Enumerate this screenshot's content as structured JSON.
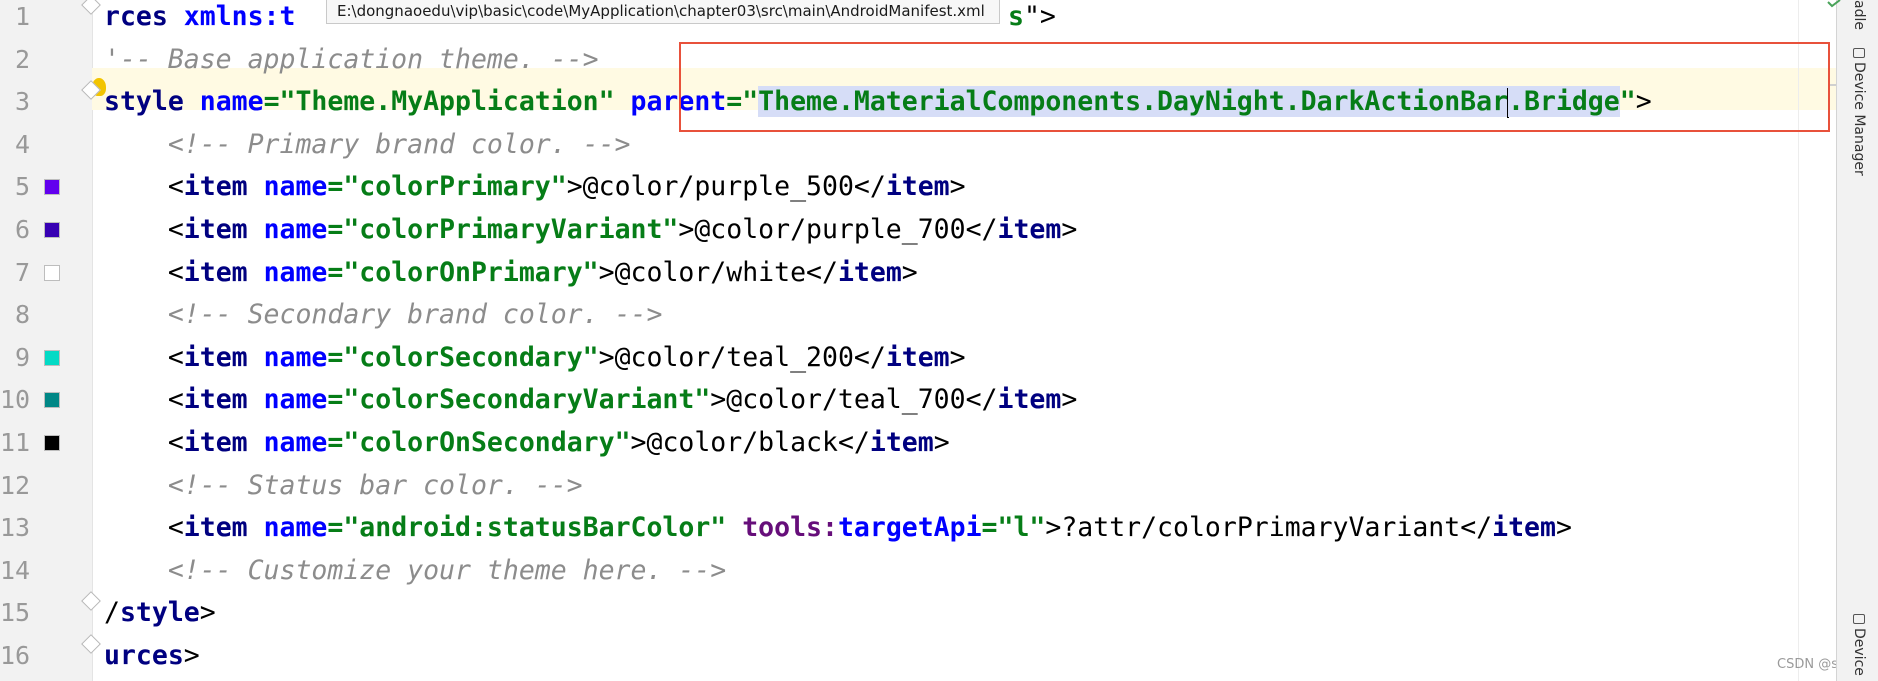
{
  "tooltip": {
    "path": "E:\\dongnaoedu\\vip\\basic\\code\\MyApplication\\chapter03\\src\\main\\AndroidManifest.xml"
  },
  "side_panel": {
    "tab_top": "Device Manager",
    "tab_bottom": "Device",
    "tab_partial": "adle"
  },
  "watermark": "CSDN @serier",
  "colors": {
    "purple_500": "#6200ee",
    "purple_700": "#3700b3",
    "white": "#ffffff",
    "teal_200": "#03dac5",
    "teal_700": "#018786",
    "black": "#000000",
    "annotation": "#e8513b"
  },
  "lines": [
    {
      "n": "1",
      "tokens": [
        {
          "c": "tag",
          "t": "rces "
        },
        {
          "c": "attr",
          "t": "xmlns:t"
        }
      ],
      "tail": [
        {
          "c": "val",
          "t": "s"
        },
        {
          "c": "txt",
          "t": "\">"
        }
      ]
    },
    {
      "n": "2",
      "tokens": [
        {
          "c": "cmt",
          "t": "'-- Base application theme. -->"
        }
      ]
    },
    {
      "n": "3",
      "tokens": [
        {
          "c": "tag",
          "t": "style "
        },
        {
          "c": "attr",
          "t": "name"
        },
        {
          "c": "val",
          "t": "=\"Theme.MyApplication\" "
        },
        {
          "c": "attr",
          "t": "parent"
        },
        {
          "c": "val",
          "t": "=\""
        },
        {
          "c": "val sel",
          "t": "Theme.MaterialComponents.DayNight.DarkActionBar"
        },
        {
          "c": "caret",
          "t": ""
        },
        {
          "c": "val sel",
          "t": ".Bridge"
        },
        {
          "c": "val",
          "t": "\""
        },
        {
          "c": "txt",
          "t": ">"
        }
      ]
    },
    {
      "n": "4",
      "tokens": [
        {
          "c": "cmt",
          "t": "    <!-- Primary brand color. -->"
        }
      ]
    },
    {
      "n": "5",
      "tokens": [
        {
          "c": "txt",
          "t": "    <"
        },
        {
          "c": "tag",
          "t": "item "
        },
        {
          "c": "attr",
          "t": "name"
        },
        {
          "c": "val",
          "t": "=\"colorPrimary\""
        },
        {
          "c": "txt",
          "t": ">@color/purple_500</"
        },
        {
          "c": "tag",
          "t": "item"
        },
        {
          "c": "txt",
          "t": ">"
        }
      ]
    },
    {
      "n": "6",
      "tokens": [
        {
          "c": "txt",
          "t": "    <"
        },
        {
          "c": "tag",
          "t": "item "
        },
        {
          "c": "attr",
          "t": "name"
        },
        {
          "c": "val",
          "t": "=\"colorPrimaryVariant\""
        },
        {
          "c": "txt",
          "t": ">@color/purple_700</"
        },
        {
          "c": "tag",
          "t": "item"
        },
        {
          "c": "txt",
          "t": ">"
        }
      ]
    },
    {
      "n": "7",
      "tokens": [
        {
          "c": "txt",
          "t": "    <"
        },
        {
          "c": "tag",
          "t": "item "
        },
        {
          "c": "attr",
          "t": "name"
        },
        {
          "c": "val",
          "t": "=\"colorOnPrimary\""
        },
        {
          "c": "txt",
          "t": ">@color/white</"
        },
        {
          "c": "tag",
          "t": "item"
        },
        {
          "c": "txt",
          "t": ">"
        }
      ]
    },
    {
      "n": "8",
      "tokens": [
        {
          "c": "cmt",
          "t": "    <!-- Secondary brand color. -->"
        }
      ]
    },
    {
      "n": "9",
      "tokens": [
        {
          "c": "txt",
          "t": "    <"
        },
        {
          "c": "tag",
          "t": "item "
        },
        {
          "c": "attr",
          "t": "name"
        },
        {
          "c": "val",
          "t": "=\"colorSecondary\""
        },
        {
          "c": "txt",
          "t": ">@color/teal_200</"
        },
        {
          "c": "tag",
          "t": "item"
        },
        {
          "c": "txt",
          "t": ">"
        }
      ]
    },
    {
      "n": "10",
      "tokens": [
        {
          "c": "txt",
          "t": "    <"
        },
        {
          "c": "tag",
          "t": "item "
        },
        {
          "c": "attr",
          "t": "name"
        },
        {
          "c": "val",
          "t": "=\"colorSecondaryVariant\""
        },
        {
          "c": "txt",
          "t": ">@color/teal_700</"
        },
        {
          "c": "tag",
          "t": "item"
        },
        {
          "c": "txt",
          "t": ">"
        }
      ]
    },
    {
      "n": "11",
      "tokens": [
        {
          "c": "txt",
          "t": "    <"
        },
        {
          "c": "tag",
          "t": "item "
        },
        {
          "c": "attr",
          "t": "name"
        },
        {
          "c": "val",
          "t": "=\"colorOnSecondary\""
        },
        {
          "c": "txt",
          "t": ">@color/black</"
        },
        {
          "c": "tag",
          "t": "item"
        },
        {
          "c": "txt",
          "t": ">"
        }
      ]
    },
    {
      "n": "12",
      "tokens": [
        {
          "c": "cmt",
          "t": "    <!-- Status bar color. -->"
        }
      ]
    },
    {
      "n": "13",
      "tokens": [
        {
          "c": "txt",
          "t": "    <"
        },
        {
          "c": "tag",
          "t": "item "
        },
        {
          "c": "attr",
          "t": "name"
        },
        {
          "c": "val",
          "t": "=\"android:statusBarColor\" "
        },
        {
          "c": "ns",
          "t": "tools:"
        },
        {
          "c": "attr",
          "t": "targetApi"
        },
        {
          "c": "val",
          "t": "=\"l\""
        },
        {
          "c": "txt",
          "t": ">?attr/colorPrimaryVariant</"
        },
        {
          "c": "tag",
          "t": "item"
        },
        {
          "c": "txt",
          "t": ">"
        }
      ]
    },
    {
      "n": "14",
      "tokens": [
        {
          "c": "cmt",
          "t": "    <!-- Customize your theme here. -->"
        }
      ]
    },
    {
      "n": "15",
      "tokens": [
        {
          "c": "txt",
          "t": "/"
        },
        {
          "c": "tag",
          "t": "style"
        },
        {
          "c": "txt",
          "t": ">"
        }
      ]
    },
    {
      "n": "16",
      "tokens": [
        {
          "c": "tag",
          "t": "urces"
        },
        {
          "c": "txt",
          "t": ">"
        }
      ]
    }
  ]
}
